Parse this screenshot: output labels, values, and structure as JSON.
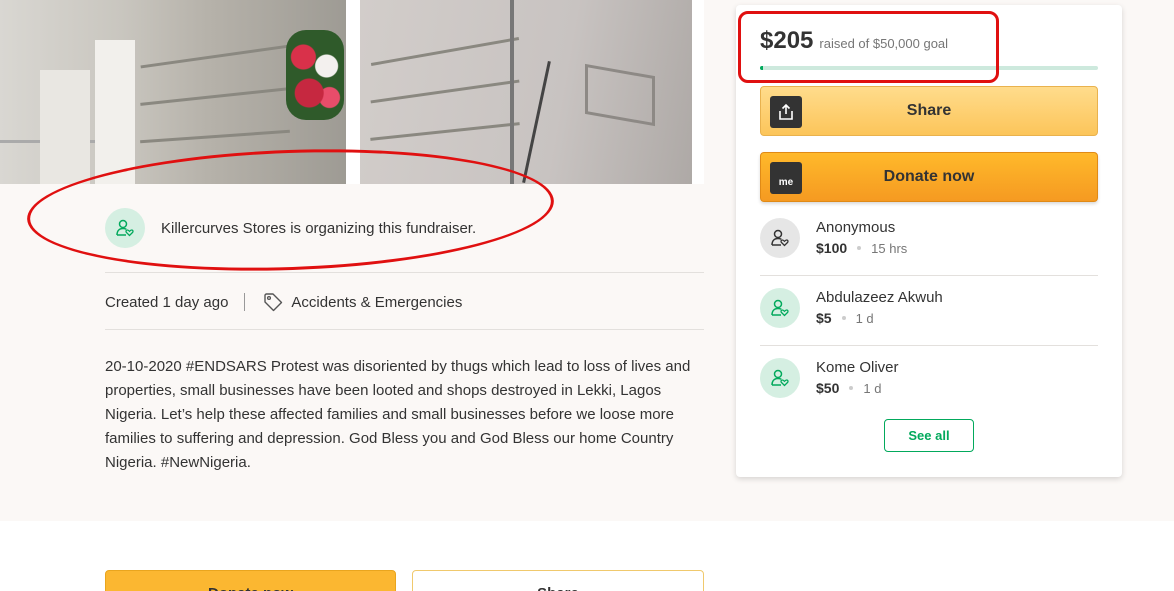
{
  "organizer": {
    "text": "Killercurves Stores is organizing this fundraiser.",
    "icon": "person-heart-icon"
  },
  "meta": {
    "created": "Created 1 day ago",
    "category": "Accidents & Emergencies",
    "category_icon": "tag-icon"
  },
  "story": "20-10-2020 #ENDSARS Protest was disoriented by thugs which lead to loss of lives and properties, small businesses have been looted and shops destroyed in Lekki, Lagos Nigeria. Let’s help these affected families and small businesses before we loose more families to suffering and depression. God Bless you and God Bless our home Country Nigeria. #NewNigeria.",
  "campaign": {
    "raised": "$205",
    "goal_text": "raised of $50,000 goal",
    "progress_fraction": 0.0041
  },
  "buttons": {
    "share": "Share",
    "donate": "Donate now",
    "see_all": "See all",
    "gofundme_icon_text": "me"
  },
  "donations": [
    {
      "name": "Anonymous",
      "amount": "$100",
      "time": "15 hrs",
      "avatar": "grey"
    },
    {
      "name": "Abdulazeez Akwuh",
      "amount": "$5",
      "time": "1 d",
      "avatar": "green"
    },
    {
      "name": "Kome Oliver",
      "amount": "$50",
      "time": "1 d",
      "avatar": "green"
    }
  ],
  "colors": {
    "brand_green": "#02a95c",
    "donate_orange": "#f59a21",
    "annotation_red": "#e01010"
  }
}
